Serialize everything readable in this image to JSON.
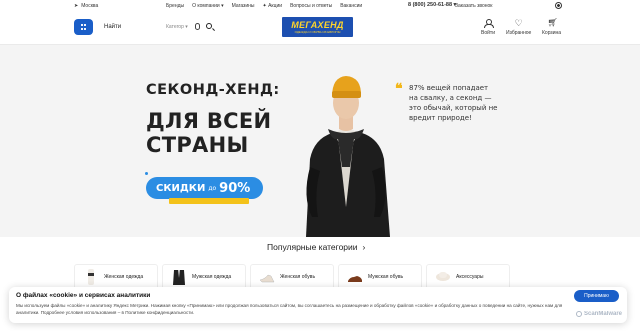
{
  "topbar": {
    "city": "Москва",
    "links": [
      "Бренды",
      "О компании",
      "Магазины",
      "Акции",
      "Вопросы и ответы",
      "Вакансии"
    ],
    "phone": "8 (800) 250-61-88",
    "callback": "Заказать звонок"
  },
  "header": {
    "search_label": "Найти",
    "category_select": "Категор",
    "logo_main": "МЕГАХЕНД",
    "logo_sub": "ОДЕЖДА И ОБУВЬ ИЗ ЕВРОПЫ",
    "actions": [
      {
        "label": "Войти",
        "icon": "user-icon"
      },
      {
        "label": "Избранное",
        "icon": "heart-icon"
      },
      {
        "label": "Корзина",
        "icon": "cart-icon"
      }
    ]
  },
  "hero": {
    "title1": "СЕКОНД-ХЕНД:",
    "title2_line1": "ДЛЯ ВСЕЙ",
    "title2_line2": "СТРАНЫ",
    "sale_prefix": "СКИДКИ",
    "sale_do": "до",
    "sale_value": "90%",
    "quote": "87% вещей попадает на свалку, а секонд — это обычай, который не вредит природе!",
    "accent_color": "#2b8de3",
    "quote_color": "#f2b71a"
  },
  "popular": {
    "title": "Популярные категории",
    "chevron": "›",
    "categories": [
      {
        "label": "Женская одежда",
        "icon": "women-clothing-icon"
      },
      {
        "label": "Мужская одежда",
        "icon": "men-clothing-icon"
      },
      {
        "label": "Женская обувь",
        "icon": "women-shoes-icon"
      },
      {
        "label": "Мужская обувь",
        "icon": "men-shoes-icon"
      },
      {
        "label": "Аксессуары",
        "icon": "accessories-icon"
      }
    ]
  },
  "cookie": {
    "title": "О файлах «cookie» и сервисах аналитики",
    "text": "Мы используем файлы «cookie» и аналитику Яндекс Метрики. Нажимая кнопку «Принимаю» или продолжая пользоваться сайтом, вы соглашаетесь на размещение и обработку файлов «cookie» и обработку данных о поведении на сайте, нужных нам для аналитики. Подробнее условия использования – в Политике конфиденциальности.",
    "accept": "Принимаю"
  },
  "watermark": "ScanMalware"
}
